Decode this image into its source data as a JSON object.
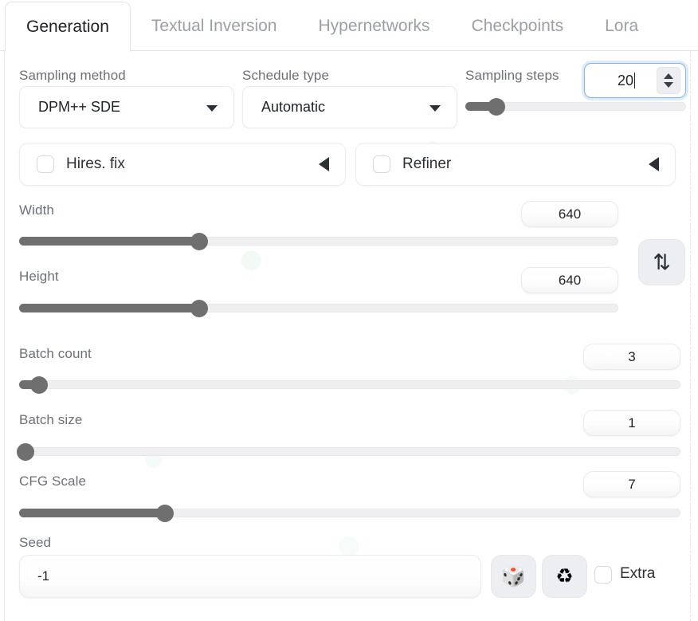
{
  "tabs": [
    {
      "label": "Generation",
      "active": true
    },
    {
      "label": "Textual Inversion",
      "active": false
    },
    {
      "label": "Hypernetworks",
      "active": false
    },
    {
      "label": "Checkpoints",
      "active": false
    },
    {
      "label": "Lora",
      "active": false
    }
  ],
  "sampling": {
    "method_label": "Sampling method",
    "method_value": "DPM++ SDE",
    "schedule_label": "Schedule type",
    "schedule_value": "Automatic",
    "steps_label": "Sampling steps",
    "steps_value": "20",
    "steps_slider_percent": 14
  },
  "accordions": [
    {
      "label": "Hires. fix",
      "checked": false,
      "expanded": false
    },
    {
      "label": "Refiner",
      "checked": false,
      "expanded": false
    }
  ],
  "dimensions": {
    "width_label": "Width",
    "width_value": "640",
    "width_slider_percent": 30,
    "height_label": "Height",
    "height_value": "640",
    "height_slider_percent": 30,
    "swap_icon": "swap-vertical-icon"
  },
  "batch": {
    "count_label": "Batch count",
    "count_value": "3",
    "count_slider_percent": 3,
    "size_label": "Batch size",
    "size_value": "1",
    "size_slider_percent": 1,
    "cfg_label": "CFG Scale",
    "cfg_value": "7",
    "cfg_slider_percent": 22
  },
  "seed": {
    "label": "Seed",
    "value": "-1",
    "placeholder": "-1",
    "dice_icon": "🎲",
    "recycle_icon": "♻",
    "extra_label": "Extra",
    "extra_checked": false
  },
  "colors": {
    "accent_focus": "#86b7dd",
    "slider_fill": "#6f6f6f",
    "slider_track": "#efeff1",
    "text_primary": "#1f2328",
    "text_muted": "#6c7078",
    "tab_inactive": "#9aa0a6"
  }
}
